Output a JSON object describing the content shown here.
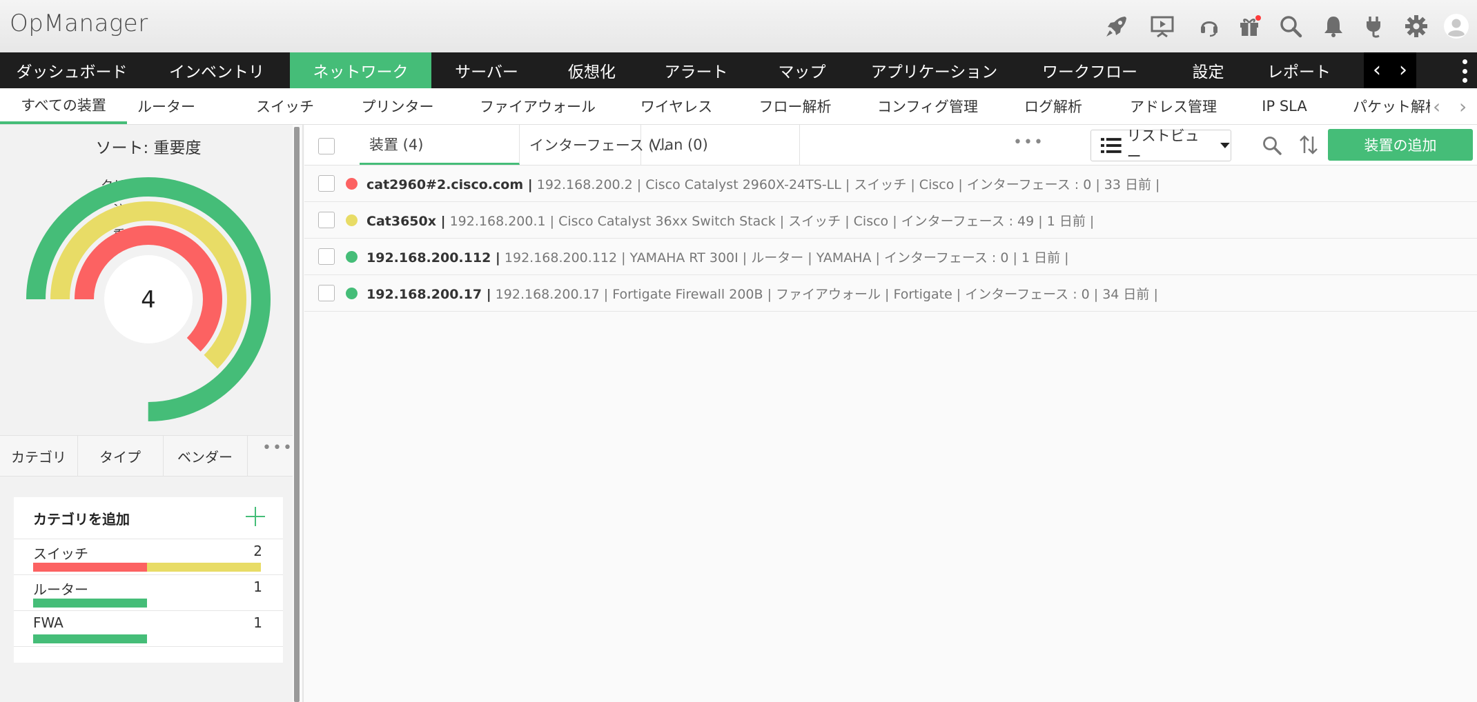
{
  "app": {
    "title": "OpManager"
  },
  "colors": {
    "accent": "#45bd78",
    "critical": "#fc6262",
    "attention": "#e8dc66",
    "clear": "#45bd78"
  },
  "header_icons": [
    "rocket-icon",
    "presentation-icon",
    "headset-icon",
    "gift-icon",
    "search-icon",
    "bell-icon",
    "plug-icon",
    "gear-icon",
    "avatar-icon"
  ],
  "main_nav": {
    "items": [
      "ダッシュボード",
      "インベントリ",
      "ネットワーク",
      "サーバー",
      "仮想化",
      "アラート",
      "マップ",
      "アプリケーション",
      "ワークフロー",
      "設定",
      "レポート"
    ],
    "active": "ネットワーク",
    "prev": "‹",
    "next": "›"
  },
  "sub_nav": {
    "items": [
      "すべての装置",
      "ルーター",
      "スイッチ",
      "プリンター",
      "ファイアウォール",
      "ワイヤレス",
      "フロー解析",
      "コンフィグ管理",
      "ログ解析",
      "アドレス管理",
      "IP SLA",
      "パケット解析"
    ],
    "active": "すべての装置"
  },
  "severity_panel": {
    "sort_label": "ソート: 重要度",
    "total": "4",
    "legend": [
      "クリア",
      "注意",
      "重大"
    ],
    "rings": [
      {
        "label": "クリア",
        "fraction": 0.75
      },
      {
        "label": "注意",
        "fraction": 0.625
      },
      {
        "label": "重大",
        "fraction": 0.625
      }
    ]
  },
  "category_tabs": [
    "カテゴリ",
    "タイプ",
    "ベンダー"
  ],
  "category_card": {
    "title": "カテゴリを追加",
    "rows": [
      {
        "name": "スイッチ",
        "count": "2",
        "critical": 1,
        "attention": 1,
        "clear": 0
      },
      {
        "name": "ルーター",
        "count": "1",
        "critical": 0,
        "attention": 0,
        "clear": 1
      },
      {
        "name": "FWA",
        "count": "1",
        "critical": 0,
        "attention": 0,
        "clear": 1
      }
    ]
  },
  "toolbar": {
    "tabs": [
      "装置 (4)",
      "インターフェース (...",
      "Vlan (0)"
    ],
    "active_tab": "装置 (4)",
    "view_label": "リストビュー",
    "add_label": "装置の追加"
  },
  "devices": [
    {
      "name": "cat2960#2.cisco.com |",
      "details": " 192.168.200.2 | Cisco Catalyst 2960X-24TS-LL | スイッチ | Cisco | インターフェース : 0 | 33 日前 |",
      "status": "critical"
    },
    {
      "name": "Cat3650x |",
      "details": " 192.168.200.1 | Cisco Catalyst 36xx Switch Stack | スイッチ | Cisco | インターフェース : 49 | 1 日前 |",
      "status": "attention"
    },
    {
      "name": "192.168.200.112 |",
      "details": " 192.168.200.112 | YAMAHA RT 300I | ルーター | YAMAHA | インターフェース : 0 | 1 日前 |",
      "status": "clear"
    },
    {
      "name": "192.168.200.17 |",
      "details": " 192.168.200.17 | Fortigate Firewall 200B | ファイアウォール | Fortigate | インターフェース : 0 | 34 日前 |",
      "status": "clear"
    }
  ]
}
